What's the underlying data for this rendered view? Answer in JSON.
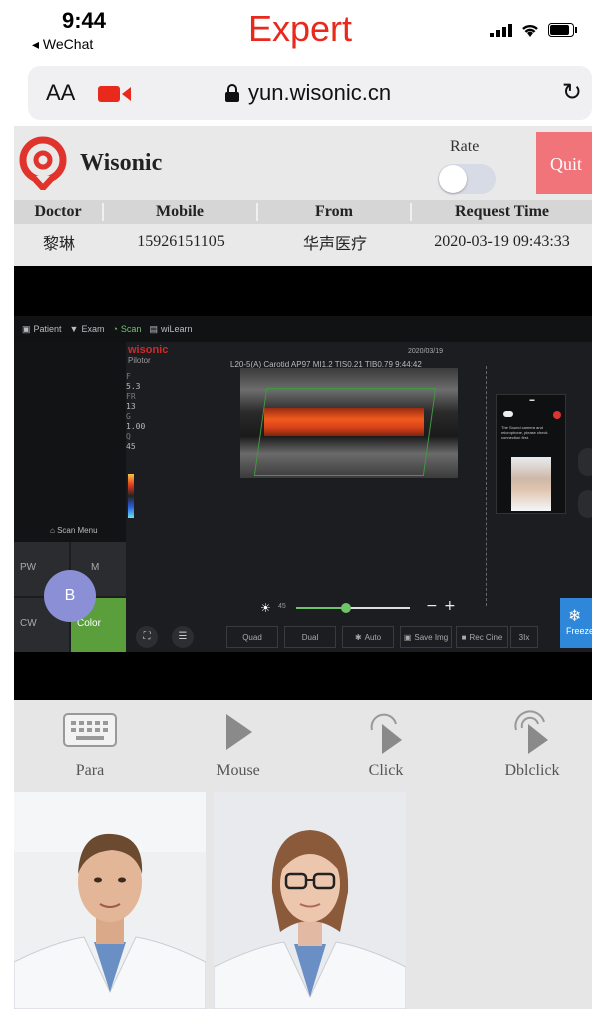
{
  "status_bar": {
    "time": "9:44",
    "back_app": "WeChat",
    "overlay_label": "Expert"
  },
  "address_bar": {
    "text_size": "AA",
    "url": "yun.wisonic.cn"
  },
  "header": {
    "brand": "Wisonic",
    "rate_label": "Rate",
    "rate_on": false,
    "quit_label": "Quit"
  },
  "info_table": {
    "columns": [
      "Doctor",
      "Mobile",
      "From",
      "Request Time"
    ],
    "row": [
      "黎琳",
      "15926151105",
      "华声医疗",
      "2020-03-19 09:43:33"
    ]
  },
  "ultrasound": {
    "tabs": [
      "Patient",
      "Exam",
      "Scan",
      "wiLearn"
    ],
    "active_tab": "Scan",
    "brand": "wisonic",
    "sub": "Pilotor",
    "probe_line": "L20-5(A)  Carotid    AP97  MI1.2  TIS0.21 TIB0.79  9:44:42",
    "date": "2020/03/19",
    "params": [
      {
        "k": "F",
        "v": "5.3"
      },
      {
        "k": "FR",
        "v": "13"
      },
      {
        "k": "G",
        "v": "1.00"
      },
      {
        "k": "Q",
        "v": "45"
      }
    ],
    "pip_msg": "The Sound camera and microphone, please check connection first.",
    "scan_menu": "Scan Menu",
    "modes": {
      "pw": "PW",
      "m": "M",
      "cw": "CW",
      "color": "Color",
      "b": "B"
    },
    "brightness": "45",
    "slider_fraction": 0.44,
    "buttons": [
      "Quad",
      "Dual",
      "Auto",
      "Save Img",
      "Rec Cine",
      "3Ix"
    ],
    "freeze": "Freeze"
  },
  "controls": [
    {
      "label": "Para",
      "icon": "keyboard-icon"
    },
    {
      "label": "Mouse",
      "icon": "cursor-icon"
    },
    {
      "label": "Click",
      "icon": "click-icon"
    },
    {
      "label": "Dblclick",
      "icon": "double-click-icon"
    }
  ]
}
